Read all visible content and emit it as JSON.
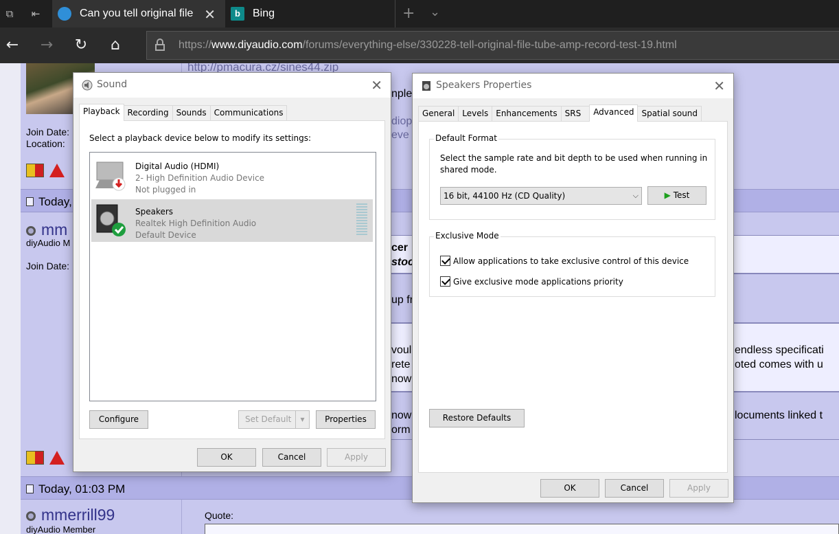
{
  "browser": {
    "tabs": [
      {
        "title": "Can you tell original file",
        "active": true
      },
      {
        "title": "Bing",
        "active": false
      }
    ],
    "url_prefix": "https://",
    "url_domain": "www.diyaudio.com",
    "url_path": "/forums/everything-else/330228-tell-original-file-tube-amp-record-test-19.html",
    "icons": {
      "tab_switch": "tab-switcher-icon",
      "set_aside": "set-aside-icon",
      "new_tab": "+",
      "tab_list": "⌄"
    }
  },
  "page": {
    "link_text": "http://pmacura.cz/sines44.zip",
    "join_date_label": "Join Date:",
    "location_label": "Location:",
    "today_label": "Today,",
    "user_partial": "mm",
    "member_partial": "diyAudio M",
    "join_date_label_2": "Join Date:",
    "date2": "Today, 01:03 PM",
    "username2": "mmerrill99",
    "member2": "diyAudio Member",
    "quote_label": "Quote:",
    "fragments": {
      "f1": "nple",
      "f2": "diop",
      "f3": "eve",
      "f4": "cer",
      "f5": "stoc",
      "f6": "up fr",
      "f7": "voul",
      "f8": "rete",
      "f9": "now",
      "f10": "now",
      "f11": "orm",
      "r1": "endless specificati",
      "r2": "oted comes with u",
      "r3": "locuments linked t"
    }
  },
  "sound_dialog": {
    "title": "Sound",
    "tabs": [
      "Playback",
      "Recording",
      "Sounds",
      "Communications"
    ],
    "instruction": "Select a playback device below to modify its settings:",
    "devices": [
      {
        "name": "Digital Audio (HDMI)",
        "line1": "2- High Definition Audio Device",
        "line2": "Not plugged in",
        "status": "unplugged"
      },
      {
        "name": "Speakers",
        "line1": "Realtek High Definition Audio",
        "line2": "Default Device",
        "status": "default"
      }
    ],
    "buttons": {
      "configure": "Configure",
      "set_default": "Set Default",
      "properties": "Properties",
      "ok": "OK",
      "cancel": "Cancel",
      "apply": "Apply"
    }
  },
  "speakers_dialog": {
    "title": "Speakers Properties",
    "tabs": [
      "General",
      "Levels",
      "Enhancements",
      "SRS",
      "Advanced",
      "Spatial sound"
    ],
    "default_format": {
      "legend": "Default Format",
      "description_line1": "Select the sample rate and bit depth to be used when running in",
      "description_line2": "shared mode.",
      "selected": "16 bit, 44100 Hz (CD Quality)",
      "test_label": "Test"
    },
    "exclusive_mode": {
      "legend": "Exclusive Mode",
      "options": [
        {
          "label": "Allow applications to take exclusive control of this device",
          "checked": true
        },
        {
          "label": "Give exclusive mode applications priority",
          "checked": true
        }
      ]
    },
    "buttons": {
      "restore": "Restore Defaults",
      "ok": "OK",
      "cancel": "Cancel",
      "apply": "Apply"
    }
  }
}
